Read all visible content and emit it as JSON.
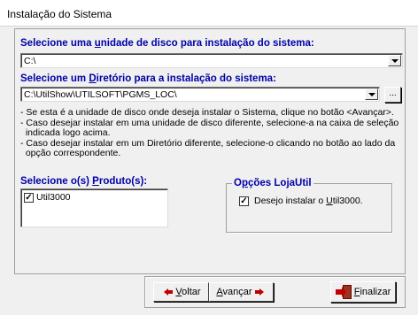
{
  "window": {
    "title": "Instalação do Sistema"
  },
  "disk": {
    "label_pre": "Selecione uma ",
    "label_key": "u",
    "label_post": "nidade de disco para instalação do sistema:",
    "value": "C:\\"
  },
  "directory": {
    "label_pre": "Selecione um ",
    "label_key": "D",
    "label_post": "iretório para a instalação do sistema:",
    "value": "C:\\UtilShow\\UTILSOFT\\PGMS_LOC\\",
    "browse_label": "..."
  },
  "info_lines": [
    "- Se esta é a unidade de disco onde deseja instalar o Sistema, clique no botão <Avançar>.",
    "- Caso desejar instalar em uma unidade de disco diferente, selecione-a na caixa de seleção",
    "  indicada logo acima.",
    "- Caso desejar instalar em um Diretório diferente, selecione-o clicando no botão ao  lado da",
    "  opção correspondente."
  ],
  "products": {
    "label_pre": "Selecione o(s) ",
    "label_key": "P",
    "label_post": "roduto(s):",
    "items": [
      {
        "label": "Util3000",
        "checked": true
      }
    ]
  },
  "loja_options": {
    "title_pre": "O",
    "title_key": "p",
    "title_post": "ções LojaUtil",
    "option_pre": "Desejo instalar o ",
    "option_key": "U",
    "option_post": "til3000.",
    "checked": true
  },
  "buttons": {
    "back": {
      "key": "V",
      "rest": "oltar"
    },
    "next": {
      "key": "A",
      "rest": "vançar"
    },
    "finish": {
      "key": "F",
      "rest": "inalizar"
    }
  },
  "icons": {
    "back": "arrow-left-icon",
    "next": "arrow-right-icon",
    "finish": "exit-door-icon"
  },
  "colors": {
    "label_blue": "#0000a8",
    "arrow_red": "#c00000"
  }
}
